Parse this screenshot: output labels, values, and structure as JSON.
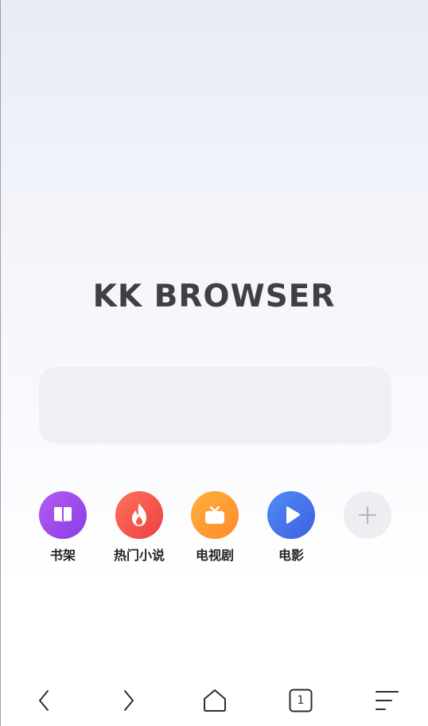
{
  "app": {
    "logo_text": "KK BROWSER"
  },
  "search": {
    "placeholder": ""
  },
  "shortcuts": [
    {
      "label": "书架",
      "icon": "book-icon",
      "color": "#9b4ded"
    },
    {
      "label": "热门小说",
      "icon": "flame-icon",
      "color": "#f2544c"
    },
    {
      "label": "电视剧",
      "icon": "tv-icon",
      "color": "#ff9a32"
    },
    {
      "label": "电影",
      "icon": "play-icon",
      "color": "#4876ea"
    },
    {
      "label": "",
      "icon": "plus-icon",
      "color": "#eceef2"
    }
  ],
  "bottom_bar": {
    "tab_count": "1",
    "buttons": [
      "back-icon",
      "forward-icon",
      "home-icon",
      "tabs-icon",
      "menu-icon"
    ]
  }
}
